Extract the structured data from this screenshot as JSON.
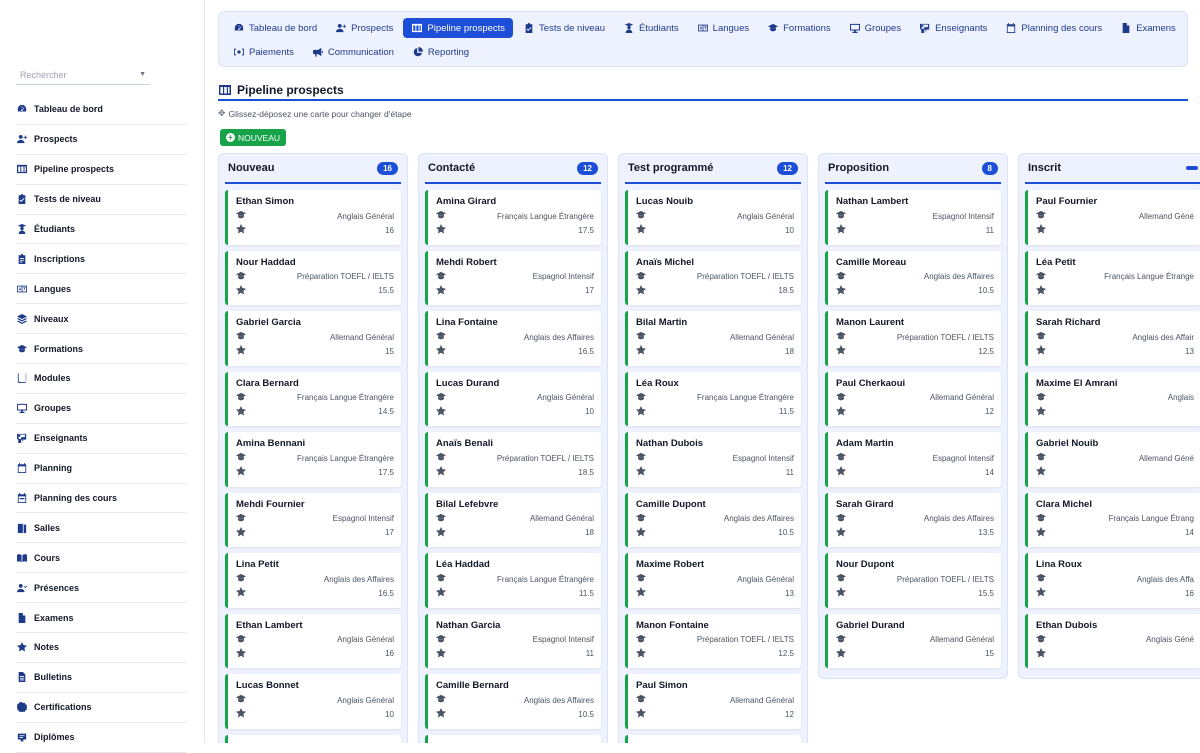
{
  "search": {
    "placeholder": "Rechercher"
  },
  "sidebar": {
    "items": [
      {
        "label": "Tableau de bord",
        "icon": "gauge-icon"
      },
      {
        "label": "Prospects",
        "icon": "user-plus-icon"
      },
      {
        "label": "Pipeline prospects",
        "icon": "columns-icon"
      },
      {
        "label": "Tests de niveau",
        "icon": "clipboard-check-icon"
      },
      {
        "label": "Étudiants",
        "icon": "student-icon"
      },
      {
        "label": "Inscriptions",
        "icon": "clipboard-list-icon"
      },
      {
        "label": "Langues",
        "icon": "language-icon"
      },
      {
        "label": "Niveaux",
        "icon": "layers-icon"
      },
      {
        "label": "Formations",
        "icon": "graduation-cap-icon"
      },
      {
        "label": "Modules",
        "icon": "book-icon"
      },
      {
        "label": "Groupes",
        "icon": "monitor-icon"
      },
      {
        "label": "Enseignants",
        "icon": "teacher-icon"
      },
      {
        "label": "Planning",
        "icon": "calendar-icon"
      },
      {
        "label": "Planning des cours",
        "icon": "calendar-week-icon"
      },
      {
        "label": "Salles",
        "icon": "door-icon"
      },
      {
        "label": "Cours",
        "icon": "book-open-icon"
      },
      {
        "label": "Présences",
        "icon": "user-check-icon"
      },
      {
        "label": "Examens",
        "icon": "file-icon"
      },
      {
        "label": "Notes",
        "icon": "star-icon"
      },
      {
        "label": "Bulletins",
        "icon": "file-alt-icon"
      },
      {
        "label": "Certifications",
        "icon": "certificate-icon"
      },
      {
        "label": "Diplômes",
        "icon": "diploma-icon"
      }
    ]
  },
  "topnav": {
    "row1": [
      {
        "label": "Tableau de bord",
        "icon": "gauge-icon",
        "active": false
      },
      {
        "label": "Prospects",
        "icon": "user-plus-icon",
        "active": false
      },
      {
        "label": "Pipeline prospects",
        "icon": "columns-icon",
        "active": true
      },
      {
        "label": "Tests de niveau",
        "icon": "clipboard-check-icon",
        "active": false
      },
      {
        "label": "Étudiants",
        "icon": "student-icon",
        "active": false
      },
      {
        "label": "Langues",
        "icon": "language-icon",
        "active": false
      },
      {
        "label": "Formations",
        "icon": "graduation-cap-icon",
        "active": false
      },
      {
        "label": "Groupes",
        "icon": "monitor-icon",
        "active": false
      },
      {
        "label": "Enseignants",
        "icon": "teacher-icon",
        "active": false
      },
      {
        "label": "Planning des cours",
        "icon": "calendar-icon",
        "active": false
      },
      {
        "label": "Examens",
        "icon": "file-icon",
        "active": false
      }
    ],
    "row2": [
      {
        "label": "Paiements",
        "icon": "money-icon",
        "active": false
      },
      {
        "label": "Communication",
        "icon": "bullhorn-icon",
        "active": false
      },
      {
        "label": "Reporting",
        "icon": "chart-pie-icon",
        "active": false
      }
    ]
  },
  "page": {
    "title": "Pipeline prospects",
    "hint": "Glissez-déposez une carte pour changer d'étape",
    "new_label": "NOUVEAU"
  },
  "colors": {
    "accent": "#1d4ed8",
    "success": "#16a34a",
    "panel": "#eef2ff"
  },
  "columns": [
    {
      "title": "Nouveau",
      "count": "16",
      "cards": [
        {
          "name": "Ethan Simon",
          "course": "Anglais Général",
          "score": "16"
        },
        {
          "name": "Nour Haddad",
          "course": "Préparation TOEFL / IELTS",
          "score": "15.5"
        },
        {
          "name": "Gabriel Garcia",
          "course": "Allemand Général",
          "score": "15"
        },
        {
          "name": "Clara Bernard",
          "course": "Français Langue Étrangère",
          "score": "14.5"
        },
        {
          "name": "Amina Bennani",
          "course": "Français Langue Étrangère",
          "score": "17.5"
        },
        {
          "name": "Mehdi Fournier",
          "course": "Espagnol Intensif",
          "score": "17"
        },
        {
          "name": "Lina Petit",
          "course": "Anglais des Affaires",
          "score": "16.5"
        },
        {
          "name": "Ethan Lambert",
          "course": "Anglais Général",
          "score": "16"
        },
        {
          "name": "Lucas Bonnet",
          "course": "Anglais Général",
          "score": "10"
        },
        {
          "name": "",
          "course": "",
          "score": ""
        }
      ]
    },
    {
      "title": "Contacté",
      "count": "12",
      "cards": [
        {
          "name": "Amina Girard",
          "course": "Français Langue Étrangère",
          "score": "17.5"
        },
        {
          "name": "Mehdi Robert",
          "course": "Espagnol Intensif",
          "score": "17"
        },
        {
          "name": "Lina Fontaine",
          "course": "Anglais des Affaires",
          "score": "16.5"
        },
        {
          "name": "Lucas Durand",
          "course": "Anglais Général",
          "score": "10"
        },
        {
          "name": "Anaïs Benali",
          "course": "Préparation TOEFL / IELTS",
          "score": "18.5"
        },
        {
          "name": "Bilal Lefebvre",
          "course": "Allemand Général",
          "score": "18"
        },
        {
          "name": "Léa Haddad",
          "course": "Français Langue Étrangère",
          "score": "11.5"
        },
        {
          "name": "Nathan Garcia",
          "course": "Espagnol Intensif",
          "score": "11"
        },
        {
          "name": "Camille Bernard",
          "course": "Anglais des Affaires",
          "score": "10.5"
        },
        {
          "name": "",
          "course": "",
          "score": ""
        }
      ]
    },
    {
      "title": "Test programmé",
      "count": "12",
      "cards": [
        {
          "name": "Lucas Nouib",
          "course": "Anglais Général",
          "score": "10"
        },
        {
          "name": "Anaïs Michel",
          "course": "Préparation TOEFL / IELTS",
          "score": "18.5"
        },
        {
          "name": "Bilal Martin",
          "course": "Allemand Général",
          "score": "18"
        },
        {
          "name": "Léa Roux",
          "course": "Français Langue Étrangère",
          "score": "11.5"
        },
        {
          "name": "Nathan Dubois",
          "course": "Espagnol Intensif",
          "score": "11"
        },
        {
          "name": "Camille Dupont",
          "course": "Anglais des Affaires",
          "score": "10.5"
        },
        {
          "name": "Maxime Robert",
          "course": "Anglais Général",
          "score": "13"
        },
        {
          "name": "Manon Fontaine",
          "course": "Préparation TOEFL / IELTS",
          "score": "12.5"
        },
        {
          "name": "Paul Simon",
          "course": "Allemand Général",
          "score": "12"
        },
        {
          "name": "",
          "course": "",
          "score": ""
        }
      ]
    },
    {
      "title": "Proposition",
      "count": "8",
      "cards": [
        {
          "name": "Nathan Lambert",
          "course": "Espagnol Intensif",
          "score": "11"
        },
        {
          "name": "Camille Moreau",
          "course": "Anglais des Affaires",
          "score": "10.5"
        },
        {
          "name": "Manon Laurent",
          "course": "Préparation TOEFL / IELTS",
          "score": "12.5"
        },
        {
          "name": "Paul Cherkaoui",
          "course": "Allemand Général",
          "score": "12"
        },
        {
          "name": "Adam Martin",
          "course": "Espagnol Intensif",
          "score": "14"
        },
        {
          "name": "Sarah Girard",
          "course": "Anglais des Affaires",
          "score": "13.5"
        },
        {
          "name": "Nour Dupont",
          "course": "Préparation TOEFL / IELTS",
          "score": "15.5"
        },
        {
          "name": "Gabriel Durand",
          "course": "Allemand Général",
          "score": "15"
        }
      ]
    },
    {
      "title": "Inscrit",
      "count": "",
      "cards": [
        {
          "name": "Paul Fournier",
          "course": "Allemand Géné",
          "score": ""
        },
        {
          "name": "Léa Petit",
          "course": "Français Langue Étrange",
          "score": ""
        },
        {
          "name": "Sarah Richard",
          "course": "Anglais des Affair",
          "score": "13"
        },
        {
          "name": "Maxime El Amrani",
          "course": "Anglais",
          "score": ""
        },
        {
          "name": "Gabriel Nouib",
          "course": "Allemand Géné",
          "score": ""
        },
        {
          "name": "Clara Michel",
          "course": "Français Langue Étrang",
          "score": "14"
        },
        {
          "name": "Lina Roux",
          "course": "Anglais des Affa",
          "score": "16"
        },
        {
          "name": "Ethan Dubois",
          "course": "Anglais Géné",
          "score": ""
        }
      ]
    }
  ]
}
